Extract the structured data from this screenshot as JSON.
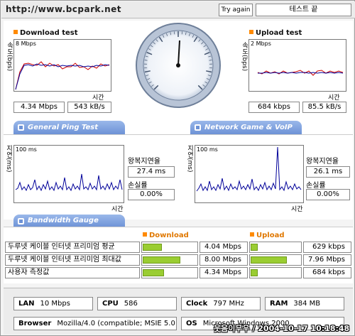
{
  "header": {
    "site_url": "http://www.bcpark.net",
    "try_again_label": "Try again",
    "end_test_label": "테스트 끝"
  },
  "download": {
    "title": "Download test",
    "ylabel": "속도(bps)",
    "scale": "8 Mbps",
    "xlabel": "시간",
    "speed": "4.34 Mbps",
    "rate": "543 kB/s"
  },
  "upload": {
    "title": "Upload test",
    "ylabel": "속도(bps)",
    "scale": "2 Mbps",
    "xlabel": "시간",
    "speed": "684 kbps",
    "rate": "85.5 kB/s"
  },
  "tabs": {
    "ping": "General Ping Test",
    "game": "Network Game & VoIP Test",
    "bandwidth": "Bandwidth Gauge"
  },
  "ping_left": {
    "ylabel": "지연(ms)",
    "scale": "100 ms",
    "xlabel": "시간",
    "rtt_label": "왕복지연율",
    "rtt_value": "27.4 ms",
    "loss_label": "손실률",
    "loss_value": "0.00%"
  },
  "ping_right": {
    "ylabel": "지연(ms)",
    "scale": "100 ms",
    "xlabel": "시간",
    "rtt_label": "왕복지연율",
    "rtt_value": "26.1 ms",
    "loss_label": "손실률",
    "loss_value": "0.00%"
  },
  "bandwidth": {
    "download_title": "Download",
    "upload_title": "Upload",
    "rows": [
      {
        "label": "두루넷 케이블 인터넷 프리미엄 평균",
        "down_value": "4.04 Mbps",
        "down_fill": 0.36,
        "up_value": "629 kbps",
        "up_fill": 0.14
      },
      {
        "label": "두루넷 케이블 인터넷 프리미엄 최대값",
        "down_value": "8.00 Mbps",
        "down_fill": 0.72,
        "up_value": "7.96 Mbps",
        "up_fill": 0.75
      },
      {
        "label": "사용자 측정값",
        "down_value": "4.34 Mbps",
        "down_fill": 0.4,
        "up_value": "684 kbps",
        "up_fill": 0.15
      }
    ]
  },
  "system": {
    "lan_label": "LAN",
    "lan_value": "10 Mbps",
    "cpu_label": "CPU",
    "cpu_value": "586",
    "clock_label": "Clock",
    "clock_value": "797 MHz",
    "ram_label": "RAM",
    "ram_value": "384 MB",
    "browser_label": "Browser",
    "browser_value": "Mozilla/4.0 (compatible; MSIE 5.0",
    "os_label": "OS",
    "os_value": "Microsoft Windows 2000"
  },
  "watermark": "웃음이무우 / 2004-10-17 10:18:48",
  "colors": {
    "accent": "#ff8a00",
    "tab": "#6d92d6",
    "bar": "#9acd32",
    "line_red": "#cc0000",
    "line_blue": "#000099"
  }
}
